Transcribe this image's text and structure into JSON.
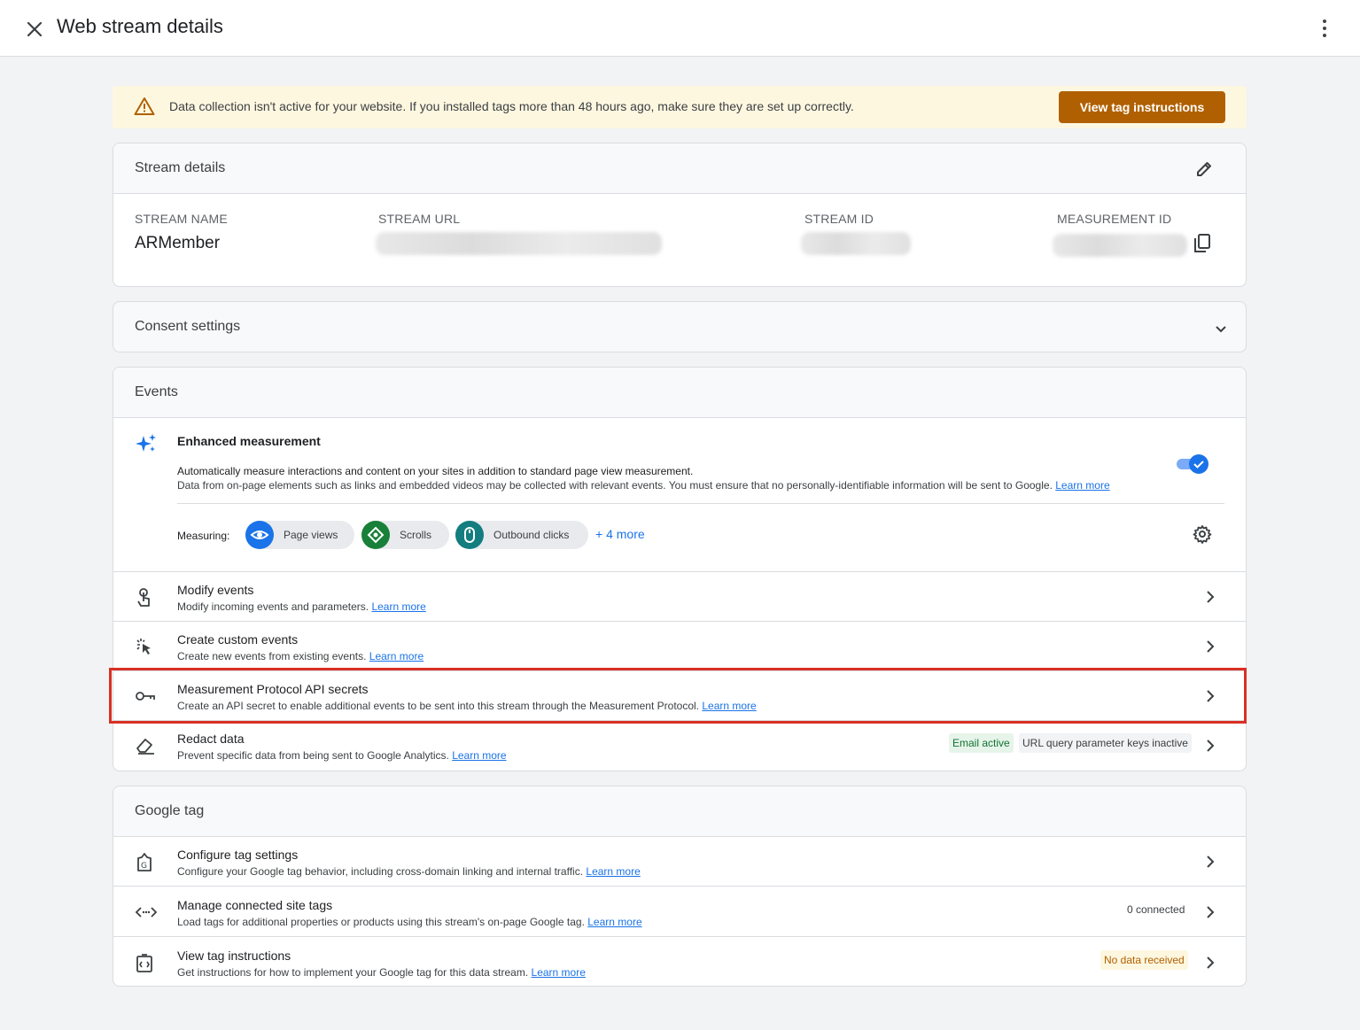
{
  "topbar": {
    "title": "Web stream details"
  },
  "banner": {
    "message": "Data collection isn't active for your website. If you installed tags more than 48 hours ago, make sure they are set up correctly.",
    "button": "View tag instructions"
  },
  "stream": {
    "header": "Stream details",
    "name_label": "STREAM NAME",
    "name_value": "ARMember",
    "url_label": "STREAM URL",
    "id_label": "STREAM ID",
    "mid_label": "MEASUREMENT ID"
  },
  "consent": {
    "header": "Consent settings"
  },
  "events": {
    "header": "Events",
    "enhanced": {
      "title": "Enhanced measurement",
      "desc1": "Automatically measure interactions and content on your sites in addition to standard page view measurement.",
      "desc2": "Data from on-page elements such as links and embedded videos may be collected with relevant events. You must ensure that no personally-identifiable information will be sent to Google.",
      "learn_more": "Learn more",
      "toggle_on": true,
      "measuring_label": "Measuring:",
      "chips": [
        "Page views",
        "Scrolls",
        "Outbound clicks"
      ],
      "more": "+ 4 more"
    },
    "rows": [
      {
        "title": "Modify events",
        "desc": "Modify incoming events and parameters.",
        "link": "Learn more"
      },
      {
        "title": "Create custom events",
        "desc": "Create new events from existing events.",
        "link": "Learn more"
      },
      {
        "title": "Measurement Protocol API secrets",
        "desc": "Create an API secret to enable additional events to be sent into this stream through the Measurement Protocol.",
        "link": "Learn more"
      },
      {
        "title": "Redact data",
        "desc": "Prevent specific data from being sent to Google Analytics.",
        "link": "Learn more",
        "badge1": "Email active",
        "badge2": "URL query parameter keys inactive"
      }
    ]
  },
  "gtag": {
    "header": "Google tag",
    "rows": [
      {
        "title": "Configure tag settings",
        "desc": "Configure your Google tag behavior, including cross-domain linking and internal traffic.",
        "link": "Learn more"
      },
      {
        "title": "Manage connected site tags",
        "desc": "Load tags for additional properties or products using this stream's on-page Google tag.",
        "link": "Learn more",
        "status": "0 connected"
      },
      {
        "title": "View tag instructions",
        "desc": "Get instructions for how to implement your Google tag for this data stream.",
        "link": "Learn more",
        "status": "No data received"
      }
    ]
  },
  "colors": {
    "accent": "#1a73e8",
    "warning_button": "#b06000",
    "banner_bg": "#fef7e0",
    "highlight": "#d93025"
  }
}
